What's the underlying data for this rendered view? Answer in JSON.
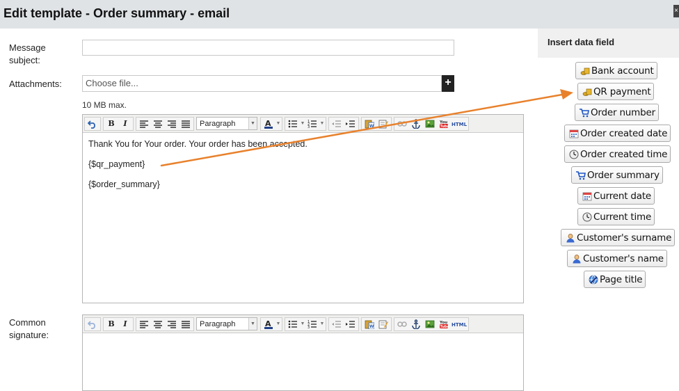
{
  "window": {
    "title": "Edit template - Order summary - email",
    "close_label": "×"
  },
  "form": {
    "subject_label": "Message subject:",
    "subject_value": "",
    "attachments_label": "Attachments:",
    "file_placeholder": "Choose file...",
    "file_add_label": "+",
    "size_hint": "10 MB max.",
    "signature_label": "Common signature:"
  },
  "editor": {
    "format_select": "Paragraph",
    "html_label": "HTML",
    "youtube_label": "You Tube",
    "lines": [
      "Thank You for Your order. Your order has been accepted.",
      "{$qr_payment}",
      "{$order_summary}"
    ]
  },
  "signature_editor": {
    "format_select": "Paragraph"
  },
  "sidebar": {
    "title": "Insert data field",
    "fields": [
      {
        "label": "Bank account",
        "icon": "coins-icon"
      },
      {
        "label": "QR payment",
        "icon": "coins-icon"
      },
      {
        "label": "Order number",
        "icon": "cart-icon"
      },
      {
        "label": "Order created date",
        "icon": "calendar-icon"
      },
      {
        "label": "Order created time",
        "icon": "clock-icon"
      },
      {
        "label": "Order summary",
        "icon": "cart-icon"
      },
      {
        "label": "Current date",
        "icon": "calendar-icon"
      },
      {
        "label": "Current time",
        "icon": "clock-icon"
      },
      {
        "label": "Customer's surname",
        "icon": "user-icon"
      },
      {
        "label": "Customer's name",
        "icon": "user-icon"
      },
      {
        "label": "Page title",
        "icon": "globe-icon"
      }
    ]
  },
  "colors": {
    "arrow": "#e8812c",
    "titlebar": "#dfe3e6",
    "sidebar_header": "#f0f0f0"
  }
}
